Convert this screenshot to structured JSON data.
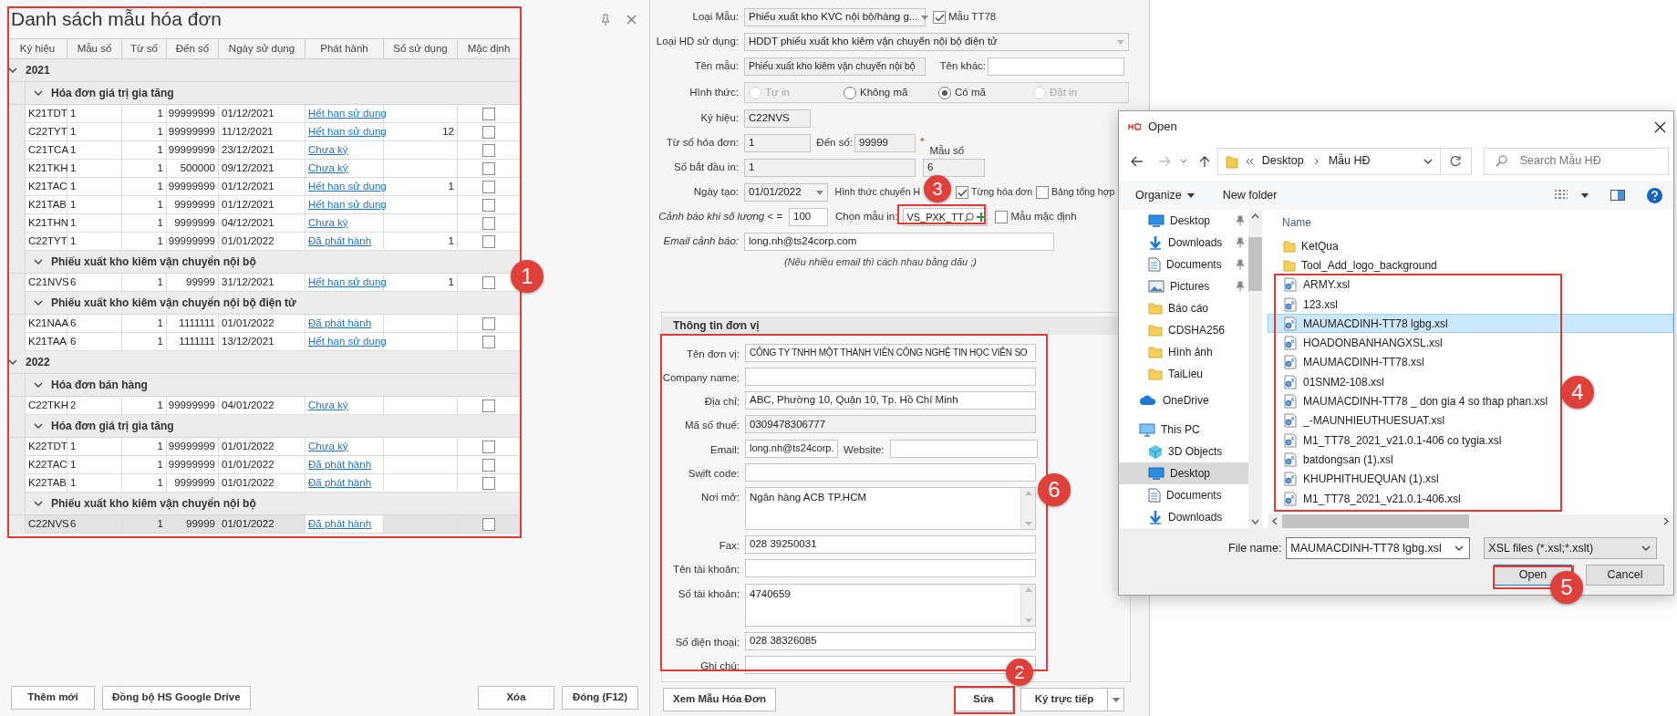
{
  "template_list": {
    "title": "Danh sách mẫu hóa đơn",
    "columns": [
      "Ký hiệu",
      "Mẫu số",
      "Từ số",
      "Đến số",
      "Ngày sử dụng",
      "Phát hành",
      "Số sử dụng",
      "Mặc định"
    ],
    "groups": [
      {
        "label": "2021",
        "expanded": true,
        "children": [
          {
            "label": "Hóa đơn giá trị gia tăng",
            "expanded": true,
            "rows": [
              {
                "ky_hieu": "K21TDT",
                "mau_so": "1",
                "tu_so": "1",
                "den_so": "99999999",
                "ngay_su_dung": "01/12/2021",
                "phat_hanh": "Hết han sử dung",
                "mac_dinh": false,
                "selected": false
              },
              {
                "ky_hieu": "C22TYT",
                "mau_so": "1",
                "tu_so": "1",
                "den_so": "99999999",
                "ngay_su_dung": "11/12/2021",
                "phat_hanh": "Hết han sử dung",
                "so_su_dung": "12",
                "mac_dinh": false,
                "selected": false
              },
              {
                "ky_hieu": "C21TCA",
                "mau_so": "1",
                "tu_so": "1",
                "den_so": "99999999",
                "ngay_su_dung": "23/12/2021",
                "phat_hanh": "Chưa ký",
                "mac_dinh": false,
                "selected": false
              },
              {
                "ky_hieu": "K21TKH",
                "mau_so": "1",
                "tu_so": "1",
                "den_so": "500000",
                "ngay_su_dung": "09/12/2021",
                "phat_hanh": "Chưa ký",
                "mac_dinh": false,
                "selected": false
              },
              {
                "ky_hieu": "K21TAC",
                "mau_so": "1",
                "tu_so": "1",
                "den_so": "99999999",
                "ngay_su_dung": "01/12/2021",
                "phat_hanh": "Hết han sử dung",
                "so_su_dung": "1",
                "mac_dinh": false,
                "selected": false
              },
              {
                "ky_hieu": "K21TAB",
                "mau_so": "1",
                "tu_so": "1",
                "den_so": "9999999",
                "ngay_su_dung": "01/12/2021",
                "phat_hanh": "Hết han sử dung",
                "mac_dinh": false,
                "selected": false
              },
              {
                "ky_hieu": "K21THN",
                "mau_so": "1",
                "tu_so": "1",
                "den_so": "9999999",
                "ngay_su_dung": "04/12/2021",
                "phat_hanh": "Chưa ký",
                "mac_dinh": false,
                "selected": false
              },
              {
                "ky_hieu": "C22TYT",
                "mau_so": "1",
                "tu_so": "1",
                "den_so": "99999999",
                "ngay_su_dung": "01/01/2022",
                "phat_hanh": "Đã phát hành",
                "so_su_dung": "1",
                "mac_dinh": false,
                "selected": false
              }
            ]
          },
          {
            "label": "Phiếu xuất kho kiêm vận chuyển nội bộ",
            "expanded": true,
            "rows": [
              {
                "ky_hieu": "C21NVS",
                "mau_so": "6",
                "tu_so": "1",
                "den_so": "99999",
                "ngay_su_dung": "31/12/2021",
                "phat_hanh": "Hết han sử dung",
                "so_su_dung": "1",
                "mac_dinh": false,
                "selected": false
              }
            ]
          },
          {
            "label": "Phiếu xuất kho kiêm vận chuyển nội bộ điện tử",
            "expanded": true,
            "rows": [
              {
                "ky_hieu": "K21NAA",
                "mau_so": "6",
                "tu_so": "1",
                "den_so": "1111111",
                "ngay_su_dung": "01/01/2022",
                "phat_hanh": "Đã phát hành",
                "mac_dinh": false,
                "selected": false
              },
              {
                "ky_hieu": "K21TAA",
                "mau_so": "6",
                "tu_so": "1",
                "den_so": "1111111",
                "ngay_su_dung": "13/12/2021",
                "phat_hanh": "Hết han sử dung",
                "mac_dinh": false,
                "selected": false
              }
            ]
          }
        ]
      },
      {
        "label": "2022",
        "expanded": true,
        "children": [
          {
            "label": "Hóa đơn bán hàng",
            "expanded": true,
            "rows": [
              {
                "ky_hieu": "C22TKH",
                "mau_so": "2",
                "tu_so": "1",
                "den_so": "99999999",
                "ngay_su_dung": "04/01/2022",
                "phat_hanh": "Chưa ký",
                "mac_dinh": false,
                "selected": false
              }
            ]
          },
          {
            "label": "Hóa đơn giá trị gia tăng",
            "expanded": true,
            "rows": [
              {
                "ky_hieu": "K22TDT",
                "mau_so": "1",
                "tu_so": "1",
                "den_so": "99999999",
                "ngay_su_dung": "01/01/2022",
                "phat_hanh": "Chưa ký",
                "mac_dinh": false,
                "selected": false
              },
              {
                "ky_hieu": "K22TAC",
                "mau_so": "1",
                "tu_so": "1",
                "den_so": "99999999",
                "ngay_su_dung": "01/01/2022",
                "phat_hanh": "Đã phát hành",
                "mac_dinh": false,
                "selected": false
              },
              {
                "ky_hieu": "K22TAB",
                "mau_so": "1",
                "tu_so": "1",
                "den_so": "9999999",
                "ngay_su_dung": "01/01/2022",
                "phat_hanh": "Đã phát hành",
                "mac_dinh": false,
                "selected": false
              }
            ]
          },
          {
            "label": "Phiếu xuất kho kiêm vận chuyển nội bộ",
            "expanded": true,
            "rows": [
              {
                "ky_hieu": "C22NVS",
                "mau_so": "6",
                "tu_so": "1",
                "den_so": "99999",
                "ngay_su_dung": "01/01/2022",
                "phat_hanh": "Đã phát hành",
                "mac_dinh": false,
                "selected": true
              }
            ]
          }
        ]
      }
    ],
    "buttons": [
      "Thêm mới",
      "Đồng bộ HS Google Drive",
      "Xóa",
      "Đóng (F12)"
    ]
  },
  "template_form": {
    "loai_mau": {
      "label": "Loại Mẫu:",
      "value": "Phiếu xuất kho KVC nội bộ/hàng g..."
    },
    "mau_tt78": {
      "label": "Mẫu TT78",
      "checked": true
    },
    "loai_hd": {
      "label": "Loại HD sử dụng:",
      "value": "HDDT phiếu xuất kho kiêm vận chuyển nội bộ điện tử"
    },
    "ten_mau": {
      "label": "Tên mẫu:",
      "value": "Phiếu xuất kho kiêm vận chuyển nội bộ"
    },
    "ten_khac": {
      "label": "Tên khác:"
    },
    "hinh_thuc": {
      "label": "Hình thức:",
      "options": [
        {
          "label": "Tự in",
          "selected": false,
          "disabled": true
        },
        {
          "label": "Không mã",
          "selected": false,
          "disabled": false
        },
        {
          "label": "Có mã",
          "selected": true,
          "disabled": false
        },
        {
          "label": "Đặt in",
          "selected": false,
          "disabled": true
        }
      ]
    },
    "ky_hieu": {
      "label": "Ký hiệu:",
      "value": "C22NVS"
    },
    "tu_so": {
      "label": "Từ số hóa đơn:",
      "value": "1"
    },
    "den_so": {
      "label": "Đến số:",
      "value": "99999",
      "required_mark": "*"
    },
    "mau_so": {
      "label": "Mẫu số",
      "value": "6"
    },
    "so_bat_dau": {
      "label": "Số bắt đầu in:",
      "value": "1"
    },
    "ngay_tao": {
      "label": "Ngày tạo:",
      "value": "01/01/2022"
    },
    "hinh_thuc_chuyen": {
      "label": "Hình thức chuyển H",
      "options": [
        {
          "label": "Từng hóa đơn",
          "checked": true
        },
        {
          "label": "Bảng tổng hợp",
          "checked": false
        }
      ]
    },
    "canh_bao": {
      "label": "Cảnh báo khi số lượng < =",
      "value": "100"
    },
    "chon_mau_in": {
      "label": "Chọn mẫu in:",
      "value": "VS_PXK_TT"
    },
    "mau_mac_dinh": {
      "label": "Mẫu mặc định",
      "checked": false
    },
    "email_canh_bao": {
      "label": "Email cảnh báo:",
      "value": "long.nh@ts24corp.com"
    },
    "hint": "(Nếu nhiều email thì cách nhau bằng dấu ;)"
  },
  "unit_info": {
    "title": "Thông tin đơn vị",
    "fields": [
      {
        "label": "Tên đơn vị:",
        "value": "CÔNG TY TNHH MỘT THÀNH VIÊN CÔNG NGHỆ TIN HỌC VIỄN SO",
        "kind": "text",
        "readonly": false
      },
      {
        "label": "Company name:",
        "kind": "text",
        "readonly": false
      },
      {
        "label": "Địa chỉ:",
        "value": "ABC, Phường 10, Quận 10, Tp. Hồ Chí Minh",
        "kind": "text",
        "readonly": false
      },
      {
        "label": "Mã số thuế:",
        "value": "0309478306777",
        "kind": "text",
        "readonly": true
      },
      {
        "label": "Email:",
        "value": "long.nh@ts24corp.",
        "kind": "email",
        "second_label": "Website:",
        "readonly": false
      },
      {
        "label": "Swift code:",
        "kind": "text",
        "readonly": false
      },
      {
        "label": "Nơi mở:",
        "value": "Ngân hàng ACB TP.HCM",
        "kind": "textarea",
        "readonly": false
      },
      {
        "label": "Fax:",
        "value": "028 39250031",
        "kind": "text",
        "readonly": false
      },
      {
        "label": "Tên tài khoản:",
        "kind": "text",
        "readonly": false
      },
      {
        "label": "Số tài khoản:",
        "value": "4740659",
        "kind": "textarea",
        "readonly": false
      },
      {
        "label": "Số điện thoại:",
        "value": "028 38326085",
        "kind": "text",
        "readonly": false
      },
      {
        "label": "Ghi chú:",
        "kind": "text",
        "readonly": false
      }
    ]
  },
  "form_buttons": [
    {
      "label": "Xem Mẫu Hóa Đơn",
      "kind": "button"
    },
    {
      "label": "Sửa",
      "kind": "button"
    },
    {
      "label": "Ký trực tiếp",
      "kind": "split"
    }
  ],
  "open_dialog": {
    "title": "Open",
    "path": [
      "Desktop",
      "Mẫu HĐ"
    ],
    "search_placeholder": "Search Mẫu HĐ",
    "toolbar": [
      "Organize",
      "New folder"
    ],
    "nav": [
      {
        "label": "Desktop",
        "kind": "desktop",
        "pinned": true,
        "selected": false
      },
      {
        "label": "Downloads",
        "kind": "download",
        "pinned": true,
        "selected": false
      },
      {
        "label": "Documents",
        "kind": "document",
        "pinned": true,
        "selected": false
      },
      {
        "label": "Pictures",
        "kind": "picture",
        "pinned": true,
        "selected": false
      },
      {
        "label": "Báo cáo",
        "kind": "folder",
        "pinned": false,
        "selected": false
      },
      {
        "label": "CDSHA256",
        "kind": "folder",
        "pinned": false,
        "selected": false
      },
      {
        "label": "Hình ảnh",
        "kind": "folder",
        "pinned": false,
        "selected": false
      },
      {
        "label": "TaiLieu",
        "kind": "folder",
        "pinned": false,
        "selected": false
      },
      {
        "label": "OneDrive",
        "kind": "cloud",
        "pinned": false,
        "selected": false
      },
      {
        "label": "This PC",
        "kind": "pc",
        "pinned": false,
        "selected": false,
        "children": [
          {
            "label": "3D Objects",
            "kind": "cube",
            "pinned": false,
            "selected": false
          },
          {
            "label": "Desktop",
            "kind": "desktop",
            "pinned": false,
            "selected": true
          },
          {
            "label": "Documents",
            "kind": "document",
            "pinned": false,
            "selected": false
          },
          {
            "label": "Downloads",
            "kind": "download",
            "pinned": false,
            "selected": false
          }
        ]
      }
    ],
    "column": "Name",
    "files": [
      {
        "name": "KetQua",
        "kind": "folder",
        "selected": false
      },
      {
        "name": "Tool_Add_logo_background",
        "kind": "folder",
        "selected": false
      },
      {
        "name": "ARMY.xsl",
        "kind": "xsl",
        "selected": false
      },
      {
        "name": "123.xsl",
        "kind": "xsl",
        "selected": false
      },
      {
        "name": "MAUMACDINH-TT78 lgbg.xsl",
        "kind": "xsl",
        "selected": true
      },
      {
        "name": "HOADONBANHANGXSL.xsl",
        "kind": "xsl",
        "selected": false
      },
      {
        "name": "MAUMACDINH-TT78.xsl",
        "kind": "xsl",
        "selected": false
      },
      {
        "name": "01SNM2-108.xsl",
        "kind": "xsl",
        "selected": false
      },
      {
        "name": "MAUMACDINH-TT78 _ don gia 4 so thap phan.xsl",
        "kind": "xsl",
        "selected": false
      },
      {
        "name": "_-MAUNHIEUTHUESUAT.xsl",
        "kind": "xsl",
        "selected": false
      },
      {
        "name": "M1_TT78_2021_v21.0.1-406 co tygia.xsl",
        "kind": "xsl",
        "selected": false
      },
      {
        "name": "batdongsan (1).xsl",
        "kind": "xsl",
        "selected": false
      },
      {
        "name": "KHUPHITHUEQUAN (1).xsl",
        "kind": "xsl",
        "selected": false
      },
      {
        "name": "M1_TT78_2021_v21.0.1-406.xsl",
        "kind": "xsl",
        "selected": false
      }
    ],
    "file_name": {
      "label": "File name:",
      "value": "MAUMACDINH-TT78 lgbg.xsl"
    },
    "file_type": "XSL files (*.xsl;*.xslt)",
    "buttons": [
      {
        "label": "Open",
        "default": true
      },
      {
        "label": "Cancel",
        "default": false
      }
    ]
  },
  "annotations": [
    {
      "number": "1"
    },
    {
      "number": "2"
    },
    {
      "number": "3"
    },
    {
      "number": "4"
    },
    {
      "number": "5"
    },
    {
      "number": "6"
    }
  ]
}
